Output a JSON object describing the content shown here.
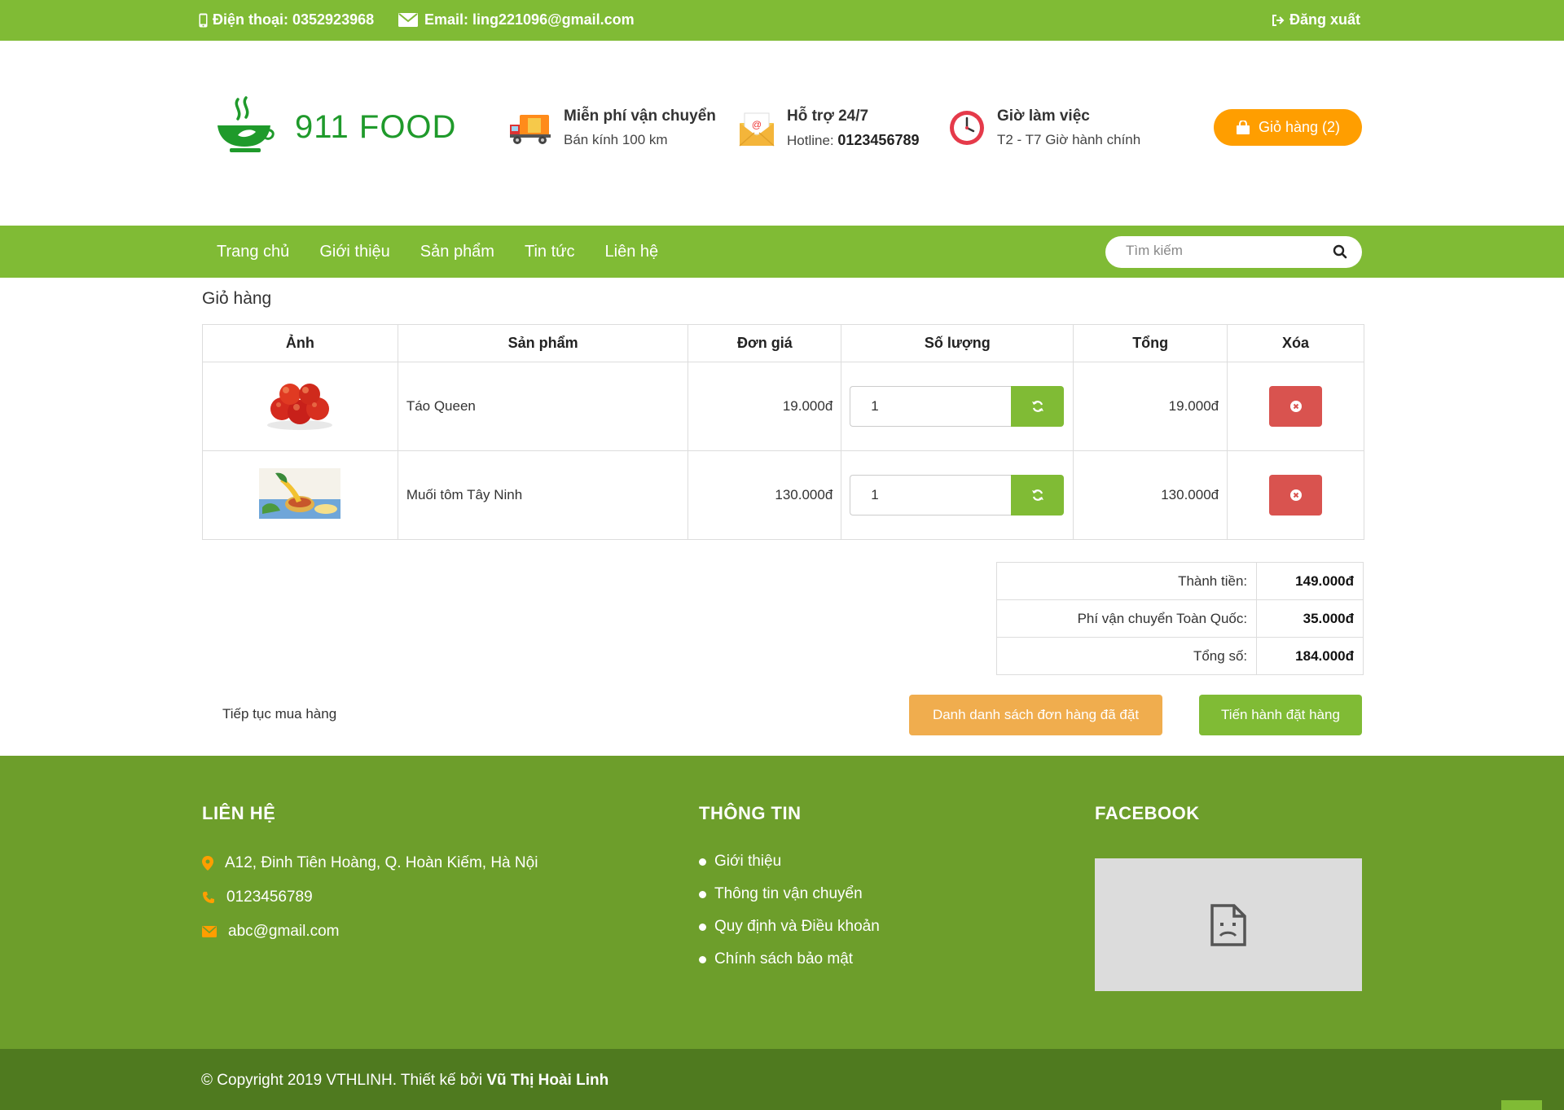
{
  "topbar": {
    "phone": "Điện thoại: 0352923968",
    "email": "Email: ling221096@gmail.com",
    "logout": "Đăng xuất"
  },
  "header": {
    "brand": "911 FOOD",
    "features": [
      {
        "icon": "truck-icon",
        "title": "Miễn phí vận chuyển",
        "subtitle": "Bán kính 100 km"
      },
      {
        "icon": "envelope-support-icon",
        "title": "Hỗ trợ 24/7",
        "subtitle_label": "Hotline:",
        "subtitle_value": "0123456789"
      },
      {
        "icon": "clock-icon",
        "title": "Giờ làm việc",
        "subtitle": "T2 - T7 Giờ hành chính"
      }
    ],
    "cart_button": "Giỏ hàng (2)"
  },
  "nav": {
    "items": [
      "Trang chủ",
      "Giới thiệu",
      "Sản phẩm",
      "Tin tức",
      "Liên hệ"
    ],
    "search_placeholder": "Tìm kiếm"
  },
  "cart": {
    "title": "Giỏ hàng",
    "columns": [
      "Ảnh",
      "Sản phẩm",
      "Đơn giá",
      "Số lượng",
      "Tổng",
      "Xóa"
    ],
    "rows": [
      {
        "image": "apples",
        "name": "Táo Queen",
        "price": "19.000đ",
        "quantity": "1",
        "total": "19.000đ"
      },
      {
        "image": "shrimp-salt",
        "name": "Muối tôm Tây Ninh",
        "price": "130.000đ",
        "quantity": "1",
        "total": "130.000đ"
      }
    ],
    "summary": [
      {
        "label": "Thành tiền:",
        "value": "149.000đ"
      },
      {
        "label": "Phí vận chuyển Toàn Quốc:",
        "value": "35.000đ"
      },
      {
        "label": "Tổng số:",
        "value": "184.000đ"
      }
    ],
    "continue_label": "Tiếp tục mua hàng",
    "orders_button": "Danh danh sách đơn hàng đã đặt",
    "checkout_button": "Tiến hành đặt hàng"
  },
  "footer": {
    "contact": {
      "heading": "LIÊN HỆ",
      "address": "A12, Đinh Tiên Hoàng, Q. Hoàn Kiếm, Hà Nội",
      "phone": "0123456789",
      "email": "abc@gmail.com"
    },
    "info": {
      "heading": "THÔNG TIN",
      "links": [
        "Giới thiệu",
        "Thông tin vận chuyển",
        "Quy định và Điều khoản",
        "Chính sách bảo mật"
      ]
    },
    "facebook": {
      "heading": "FACEBOOK"
    },
    "copyright_prefix": "© Copyright 2019 VTHLINH. Thiết kế bởi ",
    "copyright_author": "Vũ Thị Hoài Linh"
  },
  "colors": {
    "green": "#80bb35",
    "footer_green": "#6d9e2b",
    "dark_green": "#4f7a1f",
    "orange": "#ff9e00",
    "red": "#d9534f",
    "amber": "#f0ad4e"
  }
}
